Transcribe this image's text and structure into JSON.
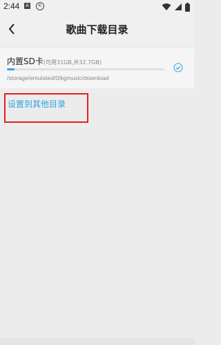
{
  "status_bar": {
    "time": "2:44",
    "icon_a_label": "A",
    "icon_k_label": "K",
    "icons_left": [
      "notification-a-icon",
      "notification-k-icon"
    ],
    "icons_right": [
      "wifi-icon",
      "signal-icon",
      "battery-icon"
    ]
  },
  "header": {
    "title": "歌曲下载目录",
    "back_icon": "back-chevron-icon"
  },
  "storage": {
    "name": "内置SD卡",
    "capacity": "(可用31GB,共32.7GB)",
    "used_fraction": 0.05,
    "path": "/storage/emulated/0/kgmusic/download",
    "selected": true
  },
  "actions": {
    "set_other_label": "设置到其他目录"
  },
  "colors": {
    "accent": "#2aa6e0",
    "highlight": "#e02020",
    "background": "#ececec"
  }
}
